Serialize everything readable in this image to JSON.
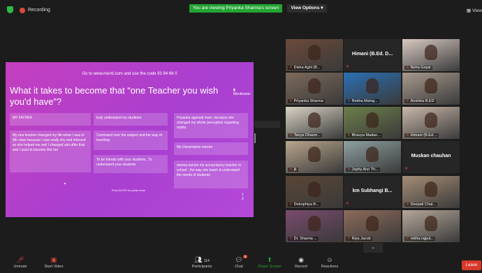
{
  "topbar": {
    "recording_label": "Recording",
    "viewing_banner": "You are viewing Priyanka Sharma's screen",
    "view_options": "View Options ▾",
    "view_button": "View"
  },
  "slide": {
    "top_line": "Go to www.menti.com and use the code 93 94 66 0",
    "title": "What it takes to become that “one Teacher you wish you'd have”?",
    "logo": "Mentimeter",
    "cards": [
      "MY FATHER",
      "My one teacher changed my life when I was in 8th class because I was really shy and introvert so she helped me and I changed alot after that and I want to become like her",
      "truly understand my students",
      "Command over the subject and her way of teaching",
      "To be friends with your students.. To understand your students",
      "Priyanka agarwal mam, because she changed my whole perception regarding maths",
      "My Dissertation mentor",
      "seema ma'am my accountancy teacher in school : the way she teach & understand the needs of students"
    ],
    "hint": "Press ENTER for private mode",
    "side_marks": "1 2"
  },
  "participants": [
    {
      "name": "Disha Aghi (B...",
      "kind": "video",
      "bg": "#6b4a3a"
    },
    {
      "name": "Himani (B.Ed. D...",
      "kind": "name"
    },
    {
      "name": "Neha Goyal",
      "kind": "video",
      "bg": "#d8c9c2"
    },
    {
      "name": "Priyanka Sharma",
      "kind": "video",
      "bg": "#7d6a5c",
      "active": true
    },
    {
      "name": "Rekha Mahaj...",
      "kind": "video",
      "bg": "#2b6fb3"
    },
    {
      "name": "Anshika B.ED",
      "kind": "video",
      "bg": "#a89a8d"
    },
    {
      "name": "Tanya Dhasm...",
      "kind": "video",
      "bg": "#d9d2c4"
    },
    {
      "name": "Bhavya Madan...",
      "kind": "video",
      "bg": "#6c7f4a"
    },
    {
      "name": "Himani (B.Ed....",
      "kind": "video",
      "bg": "#c9b7a8"
    },
    {
      "name": "jk",
      "kind": "video",
      "bg": "#b9a68c"
    },
    {
      "name": "Jophy Ann Th...",
      "kind": "video",
      "bg": "#8ea0a0"
    },
    {
      "name": "Muskan chauhan",
      "kind": "name"
    },
    {
      "name": "Debophiya B...",
      "kind": "video",
      "bg": "#5a4636"
    },
    {
      "name": "km Subhangi B...",
      "kind": "name"
    },
    {
      "name": "Deepali Chat...",
      "kind": "video",
      "bg": "#a58d76"
    },
    {
      "name": "Dr. Shavna ...",
      "kind": "video",
      "bg": "#7a4b6e"
    },
    {
      "name": "Riya Jacob",
      "kind": "video",
      "bg": "#8d6b5b"
    },
    {
      "name": "rekha.rajput...",
      "kind": "video",
      "bg": "#b5a79a"
    }
  ],
  "gallery_more": "⌄",
  "toolbar": {
    "unmute": "Unmute",
    "start_video": "Start Video",
    "participants": "Participants",
    "participants_count": "114",
    "chat": "Chat",
    "chat_badge": "3",
    "share_screen": "Share Screen",
    "record": "Record",
    "reactions": "Reactions",
    "leave": "Leave"
  }
}
